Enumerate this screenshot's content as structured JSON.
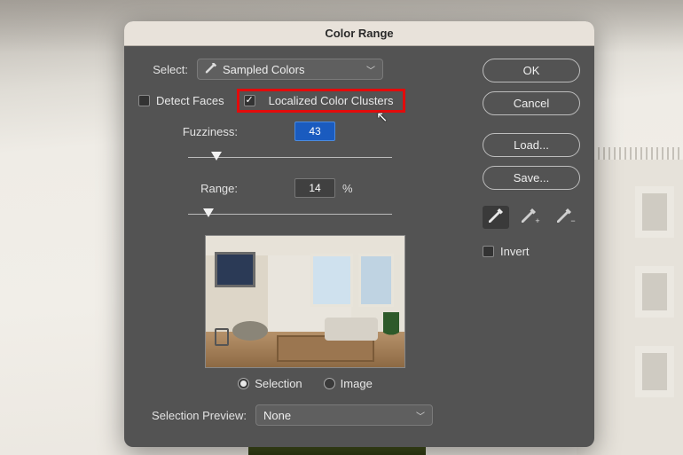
{
  "dialog": {
    "title": "Color Range",
    "select": {
      "label": "Select:",
      "value": "Sampled Colors"
    },
    "detect_faces": {
      "label": "Detect Faces",
      "checked": false
    },
    "localized": {
      "label": "Localized Color Clusters",
      "checked": true
    },
    "fuzziness": {
      "label": "Fuzziness:",
      "value": "43",
      "pct": 14
    },
    "range": {
      "label": "Range:",
      "value": "14",
      "unit": "%",
      "pct": 10
    },
    "preview_mode": {
      "selection": {
        "label": "Selection",
        "checked": true
      },
      "image": {
        "label": "Image",
        "checked": false
      }
    },
    "selection_preview": {
      "label": "Selection Preview:",
      "value": "None"
    },
    "buttons": {
      "ok": "OK",
      "cancel": "Cancel",
      "load": "Load...",
      "save": "Save..."
    },
    "invert": {
      "label": "Invert",
      "checked": false
    }
  }
}
